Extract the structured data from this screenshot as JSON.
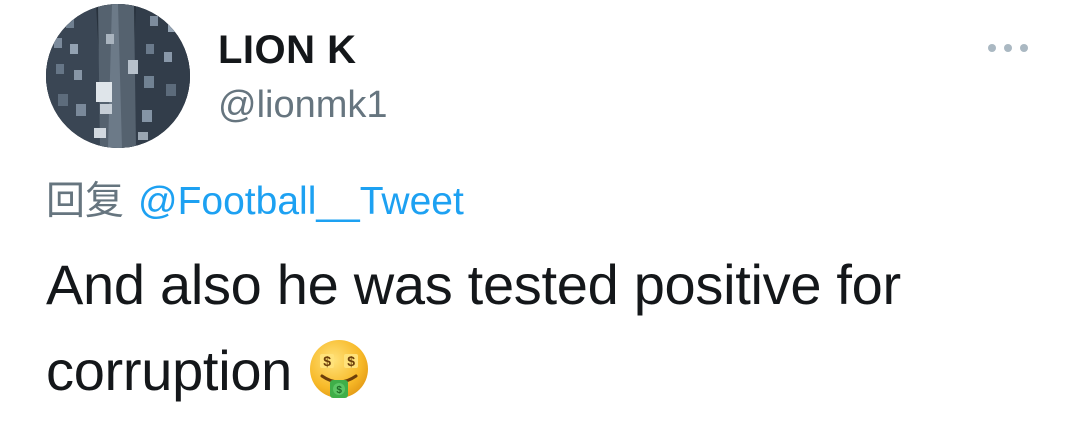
{
  "tweet": {
    "display_name": "LION K",
    "handle": "@lionmk1",
    "reply_prefix": "回复",
    "reply_to": "@Football__Tweet",
    "text": "And also he was tested positive for corruption",
    "emoji_icon": "money-mouth-face-icon",
    "more_icon": "more-options-icon"
  },
  "colors": {
    "link": "#1da1f2",
    "secondary_text": "#66757f",
    "primary_text": "#14171a",
    "more_dots": "#aab8c2"
  }
}
